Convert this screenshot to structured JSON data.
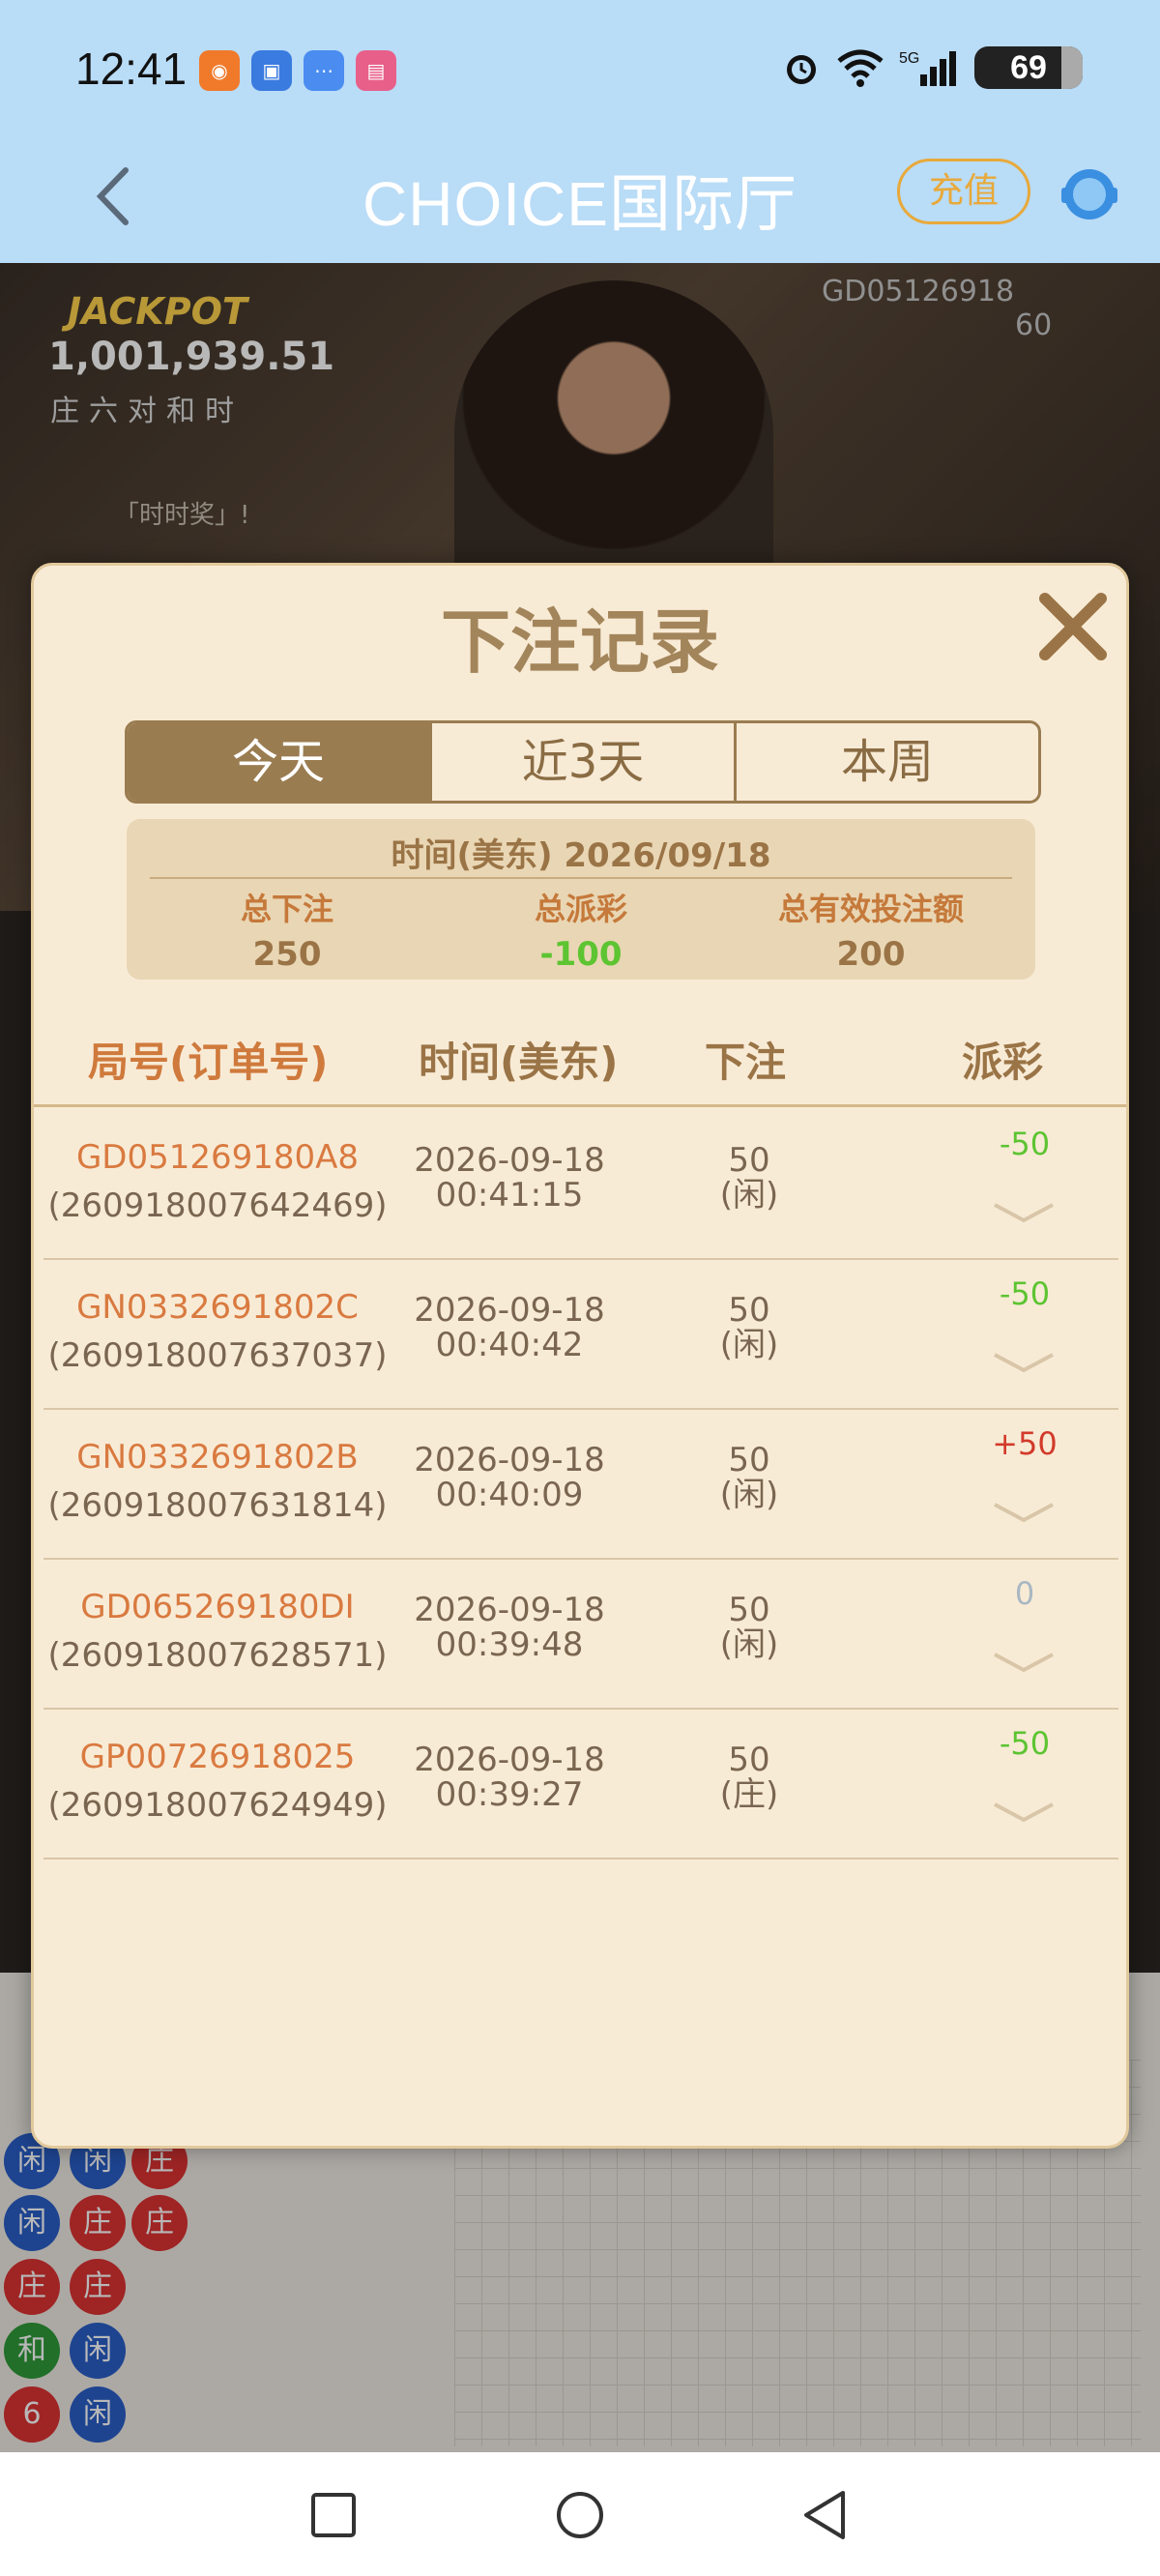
{
  "status": {
    "time": "12:41",
    "battery": "69"
  },
  "header": {
    "title": "CHOICE国际厅",
    "recharge": "充值"
  },
  "video": {
    "jackpot_label": "JACKPOT",
    "jackpot_value": "1,001,939.51",
    "jackpot_categories": "庄六对和时",
    "prize_text": "「时时奖」!",
    "round_code": "GD05126918",
    "round_num": "60"
  },
  "modal": {
    "title": "下注记录",
    "tabs": [
      "今天",
      "近3天",
      "本周"
    ],
    "active_tab": "今天",
    "summary": {
      "date": "时间(美东) 2026/09/18",
      "total_bet_label": "总下注",
      "total_bet": "250",
      "total_payout_label": "总派彩",
      "total_payout": "-100",
      "total_valid_label": "总有效投注额",
      "total_valid": "200"
    },
    "columns": [
      "局号(订单号)",
      "时间(美东)",
      "下注",
      "派彩"
    ],
    "rows": [
      {
        "round": "GD051269180A8",
        "order": "(260918007642469)",
        "date": "2026-09-18",
        "time": "00:41:15",
        "bet": "50",
        "side": "(闲)",
        "payout": "-50"
      },
      {
        "round": "GN0332691802C",
        "order": "(260918007637037)",
        "date": "2026-09-18",
        "time": "00:40:42",
        "bet": "50",
        "side": "(闲)",
        "payout": "-50"
      },
      {
        "round": "GN0332691802B",
        "order": "(260918007631814)",
        "date": "2026-09-18",
        "time": "00:40:09",
        "bet": "50",
        "side": "(闲)",
        "payout": "+50"
      },
      {
        "round": "GD065269180DI",
        "order": "(260918007628571)",
        "date": "2026-09-18",
        "time": "00:39:48",
        "bet": "50",
        "side": "(闲)",
        "payout": "0"
      },
      {
        "round": "GP00726918025",
        "order": "(260918007624949)",
        "date": "2026-09-18",
        "time": "00:39:27",
        "bet": "50",
        "side": "(庄)",
        "payout": "-50"
      }
    ]
  },
  "roadmap": {
    "beads": [
      "闲",
      "闲",
      "庄",
      "闲",
      "庄",
      "庄",
      "庄",
      "庄",
      "和",
      "闲",
      "6",
      "闲"
    ]
  },
  "colors": {
    "accent": "#9a7c51",
    "positive": "#d23a2a",
    "negative": "#5dc432",
    "header_bg": "#b9dcf7"
  },
  "icons": {
    "back": "chevron-left-icon",
    "close": "close-icon",
    "chat": "chat-icon",
    "expand": "chevron-down-icon"
  }
}
